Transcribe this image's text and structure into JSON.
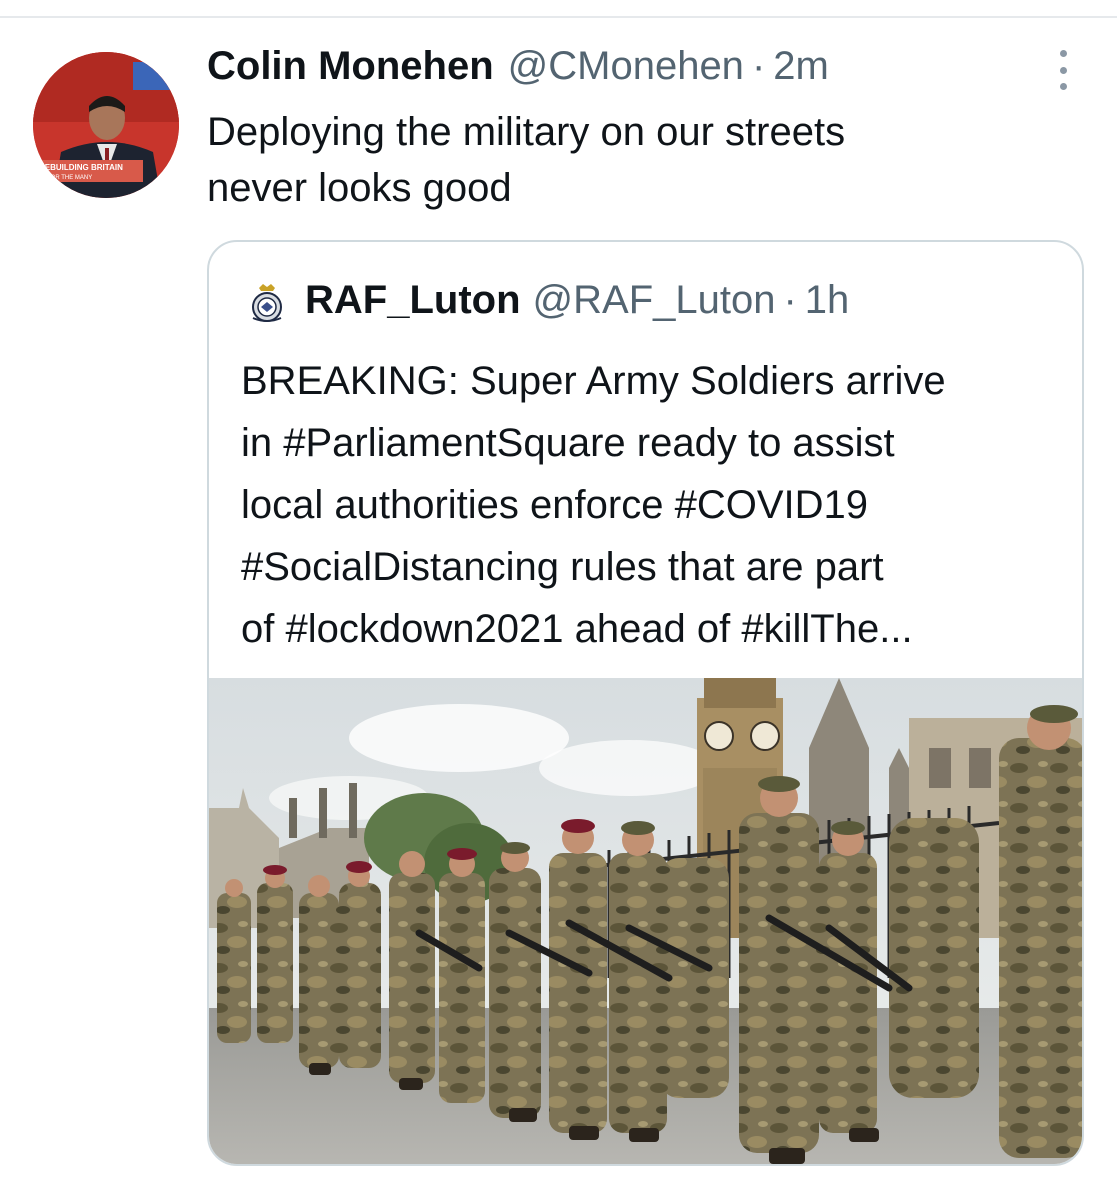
{
  "tweet": {
    "author_name": "Colin Monehen",
    "author_handle": "@CMonehen",
    "separator": "·",
    "time": "2m",
    "text_lines": [
      "Deploying the military on our streets",
      "never looks good"
    ],
    "more_icon": "more-vertical-icon",
    "avatar_banner_lines": [
      "REBUILDING BRITAIN",
      "FOR THE MANY"
    ]
  },
  "quoted_tweet": {
    "author_name": "RAF_Luton",
    "author_handle": "@RAF_Luton",
    "separator": "·",
    "time": "1h",
    "badge_icon": "raf-crest-icon",
    "text_lines": [
      "BREAKING: Super Army Soldiers arrive",
      "in #ParliamentSquare ready to assist",
      "local authorities enforce #COVID19",
      "#SocialDistancing rules that are part",
      "of #lockdown2021 ahead of #killThe..."
    ],
    "image_subject": "soldiers-marching-parliament-square"
  },
  "colors": {
    "text_primary": "#0f1419",
    "text_secondary": "#536471",
    "border": "#cfd9de",
    "avatar_background": "#c8352c"
  }
}
